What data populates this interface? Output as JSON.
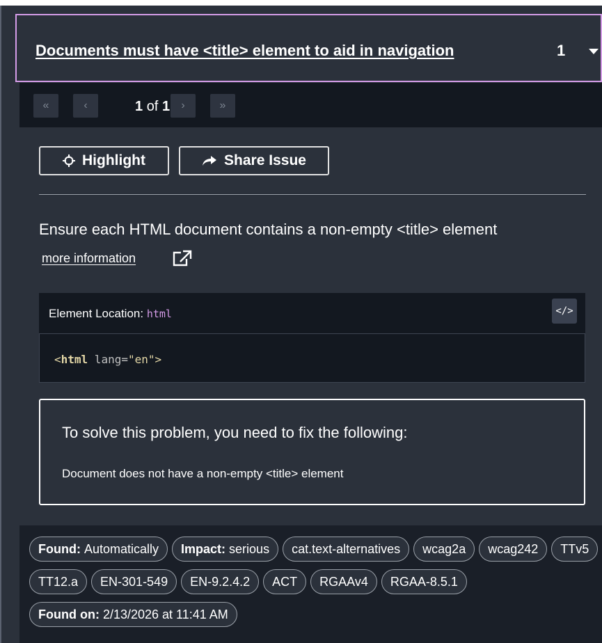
{
  "header": {
    "title": "Documents must have <title> element to aid in navigation",
    "count": "1"
  },
  "pager": {
    "first": "«",
    "prev": "‹",
    "next": "›",
    "last": "»",
    "current": "1",
    "of": "of",
    "total": "1"
  },
  "actions": {
    "highlight": "Highlight",
    "share": "Share Issue"
  },
  "issue": {
    "description": "Ensure each HTML document contains a non-empty <title> element",
    "more_info": "more information"
  },
  "element_location": {
    "label": "Element Location:",
    "selector": "html",
    "code_toggle": "</>",
    "code": {
      "open": "<",
      "tag": "html",
      "attr": " lang=",
      "value": "\"en\"",
      "close": ">"
    }
  },
  "solve": {
    "title": "To solve this problem, you need to fix the following:",
    "item": "Document does not have a non-empty <title> element"
  },
  "tags": {
    "found_label": "Found:",
    "found_value": "Automatically",
    "impact_label": "Impact:",
    "impact_value": "serious",
    "list": [
      "cat.text-alternatives",
      "wcag2a",
      "wcag242",
      "TTv5",
      "TT12.a",
      "EN-301-549",
      "EN-9.2.4.2",
      "ACT",
      "RGAAv4",
      "RGAA-8.5.1"
    ],
    "found_on_label": "Found on:",
    "found_on_value": "2/13/2026 at 11:41 AM"
  }
}
